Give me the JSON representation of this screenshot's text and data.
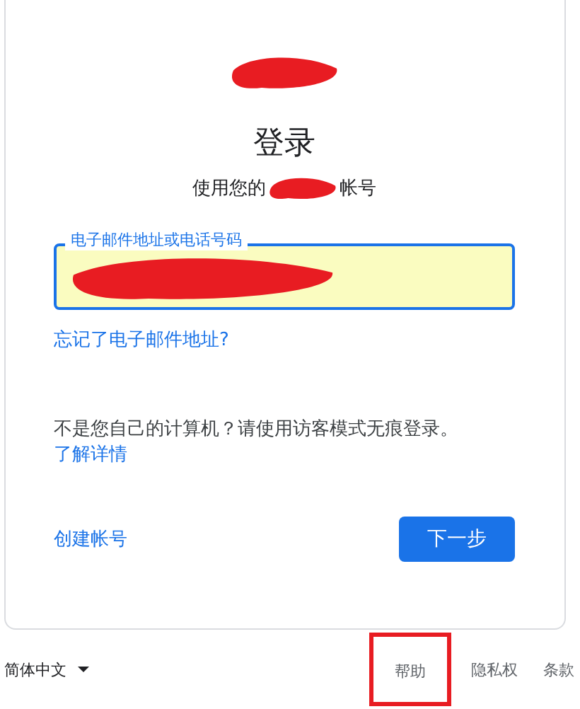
{
  "logo": {
    "redacted": true
  },
  "title": "登录",
  "subtitle": {
    "before": "使用您的",
    "after": "帐号",
    "redacted": true
  },
  "email_field": {
    "label": "电子邮件地址或电话号码",
    "autofilled": true,
    "redacted": true
  },
  "forgot_link": "忘记了电子邮件地址?",
  "guest_note": {
    "text": "不是您自己的计算机？请使用访客模式无痕登录。",
    "link": "了解详情"
  },
  "create_account": "创建帐号",
  "next_button": "下一步",
  "footer": {
    "language": "简体中文",
    "links": [
      {
        "label": "帮助",
        "highlighted": true
      },
      {
        "label": "隐私权",
        "highlighted": false
      },
      {
        "label": "条款",
        "highlighted": false
      }
    ]
  }
}
